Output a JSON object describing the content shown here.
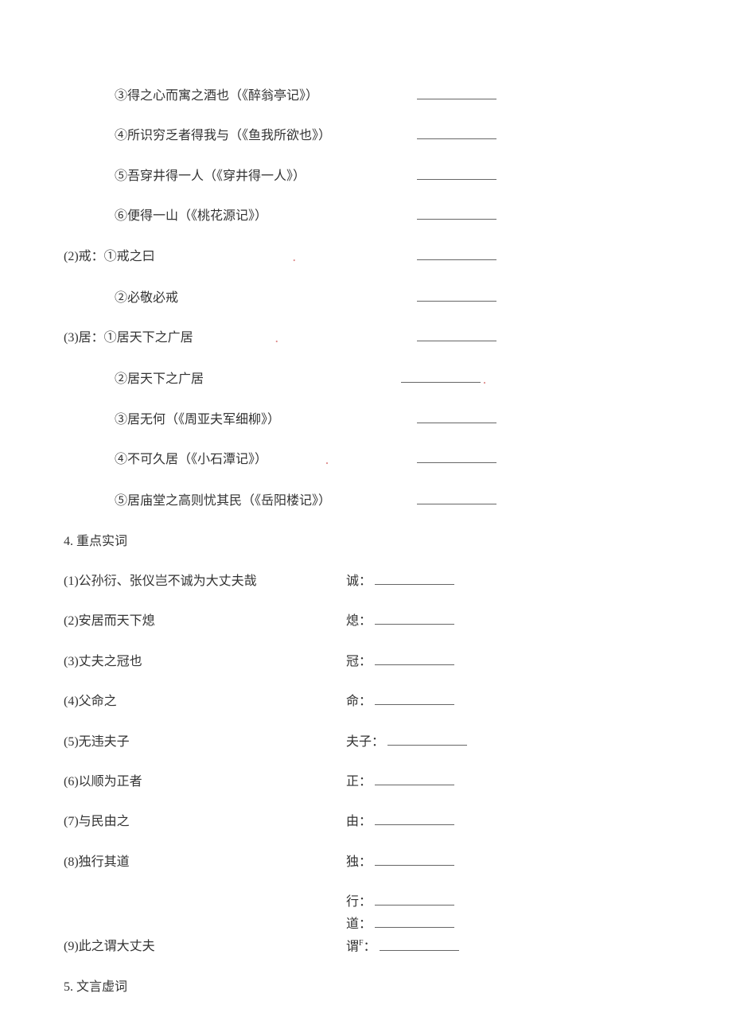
{
  "items1": [
    {
      "text": "③得之心而寓之酒也（《醉翁亭记》）",
      "indent": 2,
      "blankRight": true
    },
    {
      "text": "④所识穷乏者得我与（《鱼我所欲也》）",
      "indent": 2,
      "blankRight": true
    },
    {
      "text": "⑤吾穿井得一人（《穿井得一人》）",
      "indent": 2,
      "blankRight": true
    },
    {
      "text": "⑥便得一山（《桃花源记》）",
      "indent": 2,
      "blankRight": true
    }
  ],
  "group2": {
    "label": "(2)戒：",
    "items": [
      {
        "text": "①戒之曰",
        "mark": true,
        "blankRight": true,
        "blankLeft": 440
      },
      {
        "text": "②必敬必戒",
        "blankRight": true,
        "blankLeft": 440
      }
    ]
  },
  "group3": {
    "label": "(3)居：",
    "items": [
      {
        "text": "①居天下之广居",
        "mark": true,
        "blankRight": true,
        "blankLeft": 440
      },
      {
        "text": "②居天下之广居",
        "blankRight": true,
        "blankLeft": 440,
        "trailMark": true
      },
      {
        "text": "③居无何（《周亚夫军细柳》）",
        "blankRight": true,
        "blankLeft": 440
      },
      {
        "text": "④不可久居（《小石潭记》）",
        "mark": true,
        "blankRight": true,
        "blankLeft": 440
      },
      {
        "text": "⑤居庙堂之高则忧其民（《岳阳楼记》）",
        "blankRight": true,
        "blankLeft": 440
      }
    ]
  },
  "section4": {
    "title": "4. 重点实词",
    "items": [
      {
        "left": "(1)公孙衍、张仪岂不诚为大丈夫哉",
        "rightLabel": "诚："
      },
      {
        "left": "(2)安居而天下熄",
        "rightLabel": "熄："
      },
      {
        "left": "(3)丈夫之冠也",
        "rightLabel": "冠："
      },
      {
        "left": "(4)父命之",
        "rightLabel": "命："
      },
      {
        "left": "(5)无违夫子",
        "rightLabel": "夫子："
      },
      {
        "left": "(6)以顺为正者",
        "rightLabel": "正："
      },
      {
        "left": "(7)与民由之",
        "rightLabel": "由："
      },
      {
        "left": "(8)独行其道",
        "rightLabel": "独："
      },
      {
        "left": "",
        "rightLabel": "行："
      },
      {
        "left": "",
        "rightLabel": "道："
      },
      {
        "left": "(9)此之谓大丈夫",
        "rightLabel": "谓",
        "superscript": "F",
        "suffix": "："
      }
    ]
  },
  "section5": {
    "title": "5. 文言虚词"
  }
}
